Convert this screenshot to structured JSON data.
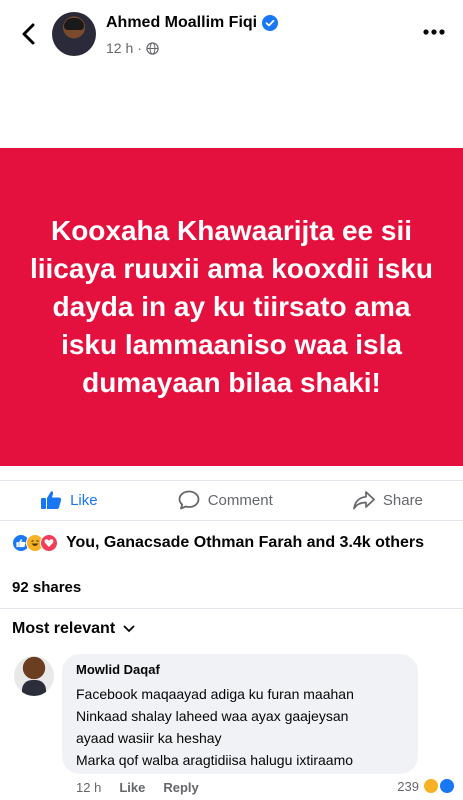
{
  "header": {
    "author_name": "Ahmed Moallim Fiqi",
    "timestamp": "12 h",
    "separator": "·",
    "privacy_icon": "globe-icon",
    "verified_icon": "verified-badge-icon"
  },
  "post": {
    "background_color": "#e4113f",
    "text": "Kooxaha Khawaarijta ee sii liicaya ruuxii ama kooxdii isku dayda in ay ku tiirsato ama isku lammaaniso waa isla dumayaan bilaa shaki!"
  },
  "actions": {
    "like_label": "Like",
    "comment_label": "Comment",
    "share_label": "Share"
  },
  "reactions": {
    "summary": "You, Ganacsade Othman Farah and 3.4k others",
    "icons": [
      "like-reaction-icon",
      "haha-reaction-icon",
      "love-reaction-icon"
    ]
  },
  "shares": "92 shares",
  "sort": {
    "label": "Most relevant"
  },
  "comment": {
    "author": "Mowlid Daqaf",
    "lines": [
      "Facebook maqaayad adiga ku furan maahan",
      "Ninkaad shalay laheed waa ayax gaajeysan",
      "ayaad wasiir ka heshay",
      "Marka qof walba aragtidiisa halugu ixtiraamo"
    ],
    "time": "12 h",
    "like_label": "Like",
    "reply_label": "Reply",
    "reaction_count": "239"
  },
  "colors": {
    "accent": "#1877f2",
    "post_bg": "#e4113f",
    "muted_text": "#65676b"
  }
}
